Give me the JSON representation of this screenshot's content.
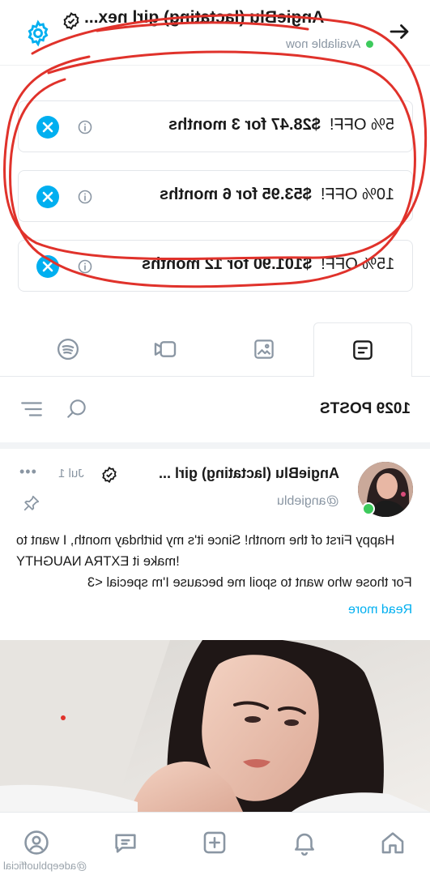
{
  "header": {
    "title": "AngieBlu (lactating) girl nex...",
    "status": "Available now"
  },
  "promos": [
    {
      "discount": "5% OFF!",
      "price": "$28.47",
      "term": "for 3 months"
    },
    {
      "discount": "10% OFF!",
      "price": "$53.95",
      "term": "for 6 months"
    },
    {
      "discount": "15% OFF!",
      "price": "$101.90",
      "term": "for 12 months"
    }
  ],
  "tabs": [
    "posts-tab",
    "photos-tab",
    "videos-tab",
    "audio-tab"
  ],
  "posts": {
    "count_label": "1029 POSTS"
  },
  "post": {
    "author": "AngieBlu (lactating) girl ...",
    "handle": "@angieblu",
    "date": "Jul 1",
    "more": "•••",
    "text_line1": "Happy First of the month! Since it's my birthday month, I want to make it EXTRA NAUGHTY!",
    "text_line2": "For those who want to spoil me because I'm special <3",
    "read_more": "Read more"
  },
  "watermark": "@adeepbluofficial",
  "colors": {
    "accent": "#00aff0",
    "online": "#3dca5c",
    "muted": "#8a96a3",
    "scribble": "#e0322b"
  }
}
